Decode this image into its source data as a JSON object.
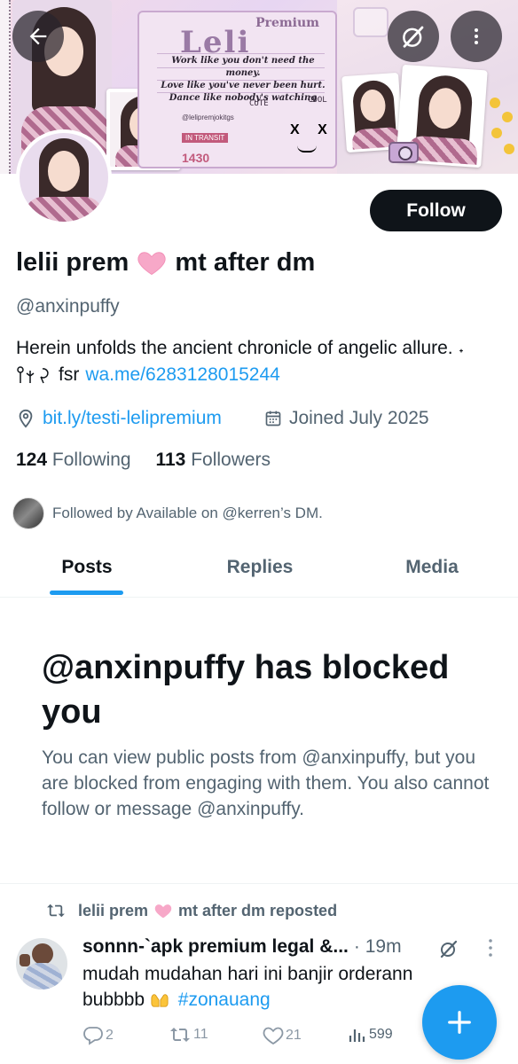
{
  "banner": {
    "premium_label": "Premium",
    "brand": "Leli",
    "quote_lines": [
      "Work like you don't need the money.",
      "Love like you've never been hurt.",
      "Dance like nobody's watching"
    ],
    "cute_label": "CUTE",
    "cool_label": "COOL",
    "ticket_handle": "@lelipremjokitgs",
    "ticket_stamp": "IN TRANSIT",
    "ticket_number": "1430",
    "face_marks": "X X"
  },
  "header": {
    "back_icon": "arrow-left-icon",
    "grok_icon": "grok-icon",
    "more_icon": "more-vertical-icon"
  },
  "profile": {
    "follow_label": "Follow",
    "name_part1": "lelii prem",
    "name_part2": "mt after dm",
    "handle": "@anxinpuffy",
    "bio_line1": "Herein unfolds the ancient chronicle of angelic allure. ˖",
    "bio_line2_prefix": "fsr",
    "bio_link": "wa.me/6283128015244",
    "website": "bit.ly/testi-lelipremium",
    "joined": "Joined July 2025",
    "following_count": "124",
    "following_label": "Following",
    "followers_count": "113",
    "followers_label": "Followers",
    "followed_by": "Followed by Available on @kerren’s DM."
  },
  "tabs": [
    {
      "label": "Posts",
      "active": true
    },
    {
      "label": "Replies",
      "active": false
    },
    {
      "label": "Media",
      "active": false
    }
  ],
  "blocked": {
    "title": "@anxinpuffy has blocked you",
    "text": "You can view public posts from @anxinpuffy, but you are blocked from engaging with them. You also cannot follow or message @anxinpuffy."
  },
  "post": {
    "repost_name1": "lelii prem",
    "repost_name2": "mt after dm reposted",
    "author": "sonnn-`apk premium legal &...",
    "time": "· 19m",
    "body_text": "mudah mudahan hari ini banjir orderann bubbbb",
    "hashtag": "#zonauang",
    "replies": "2",
    "reposts": "11",
    "likes": "21",
    "views": "599"
  },
  "colors": {
    "accent": "#1d9bf0",
    "text": "#0f1419",
    "secondary": "#536471",
    "heart": "#f7a8c8"
  }
}
